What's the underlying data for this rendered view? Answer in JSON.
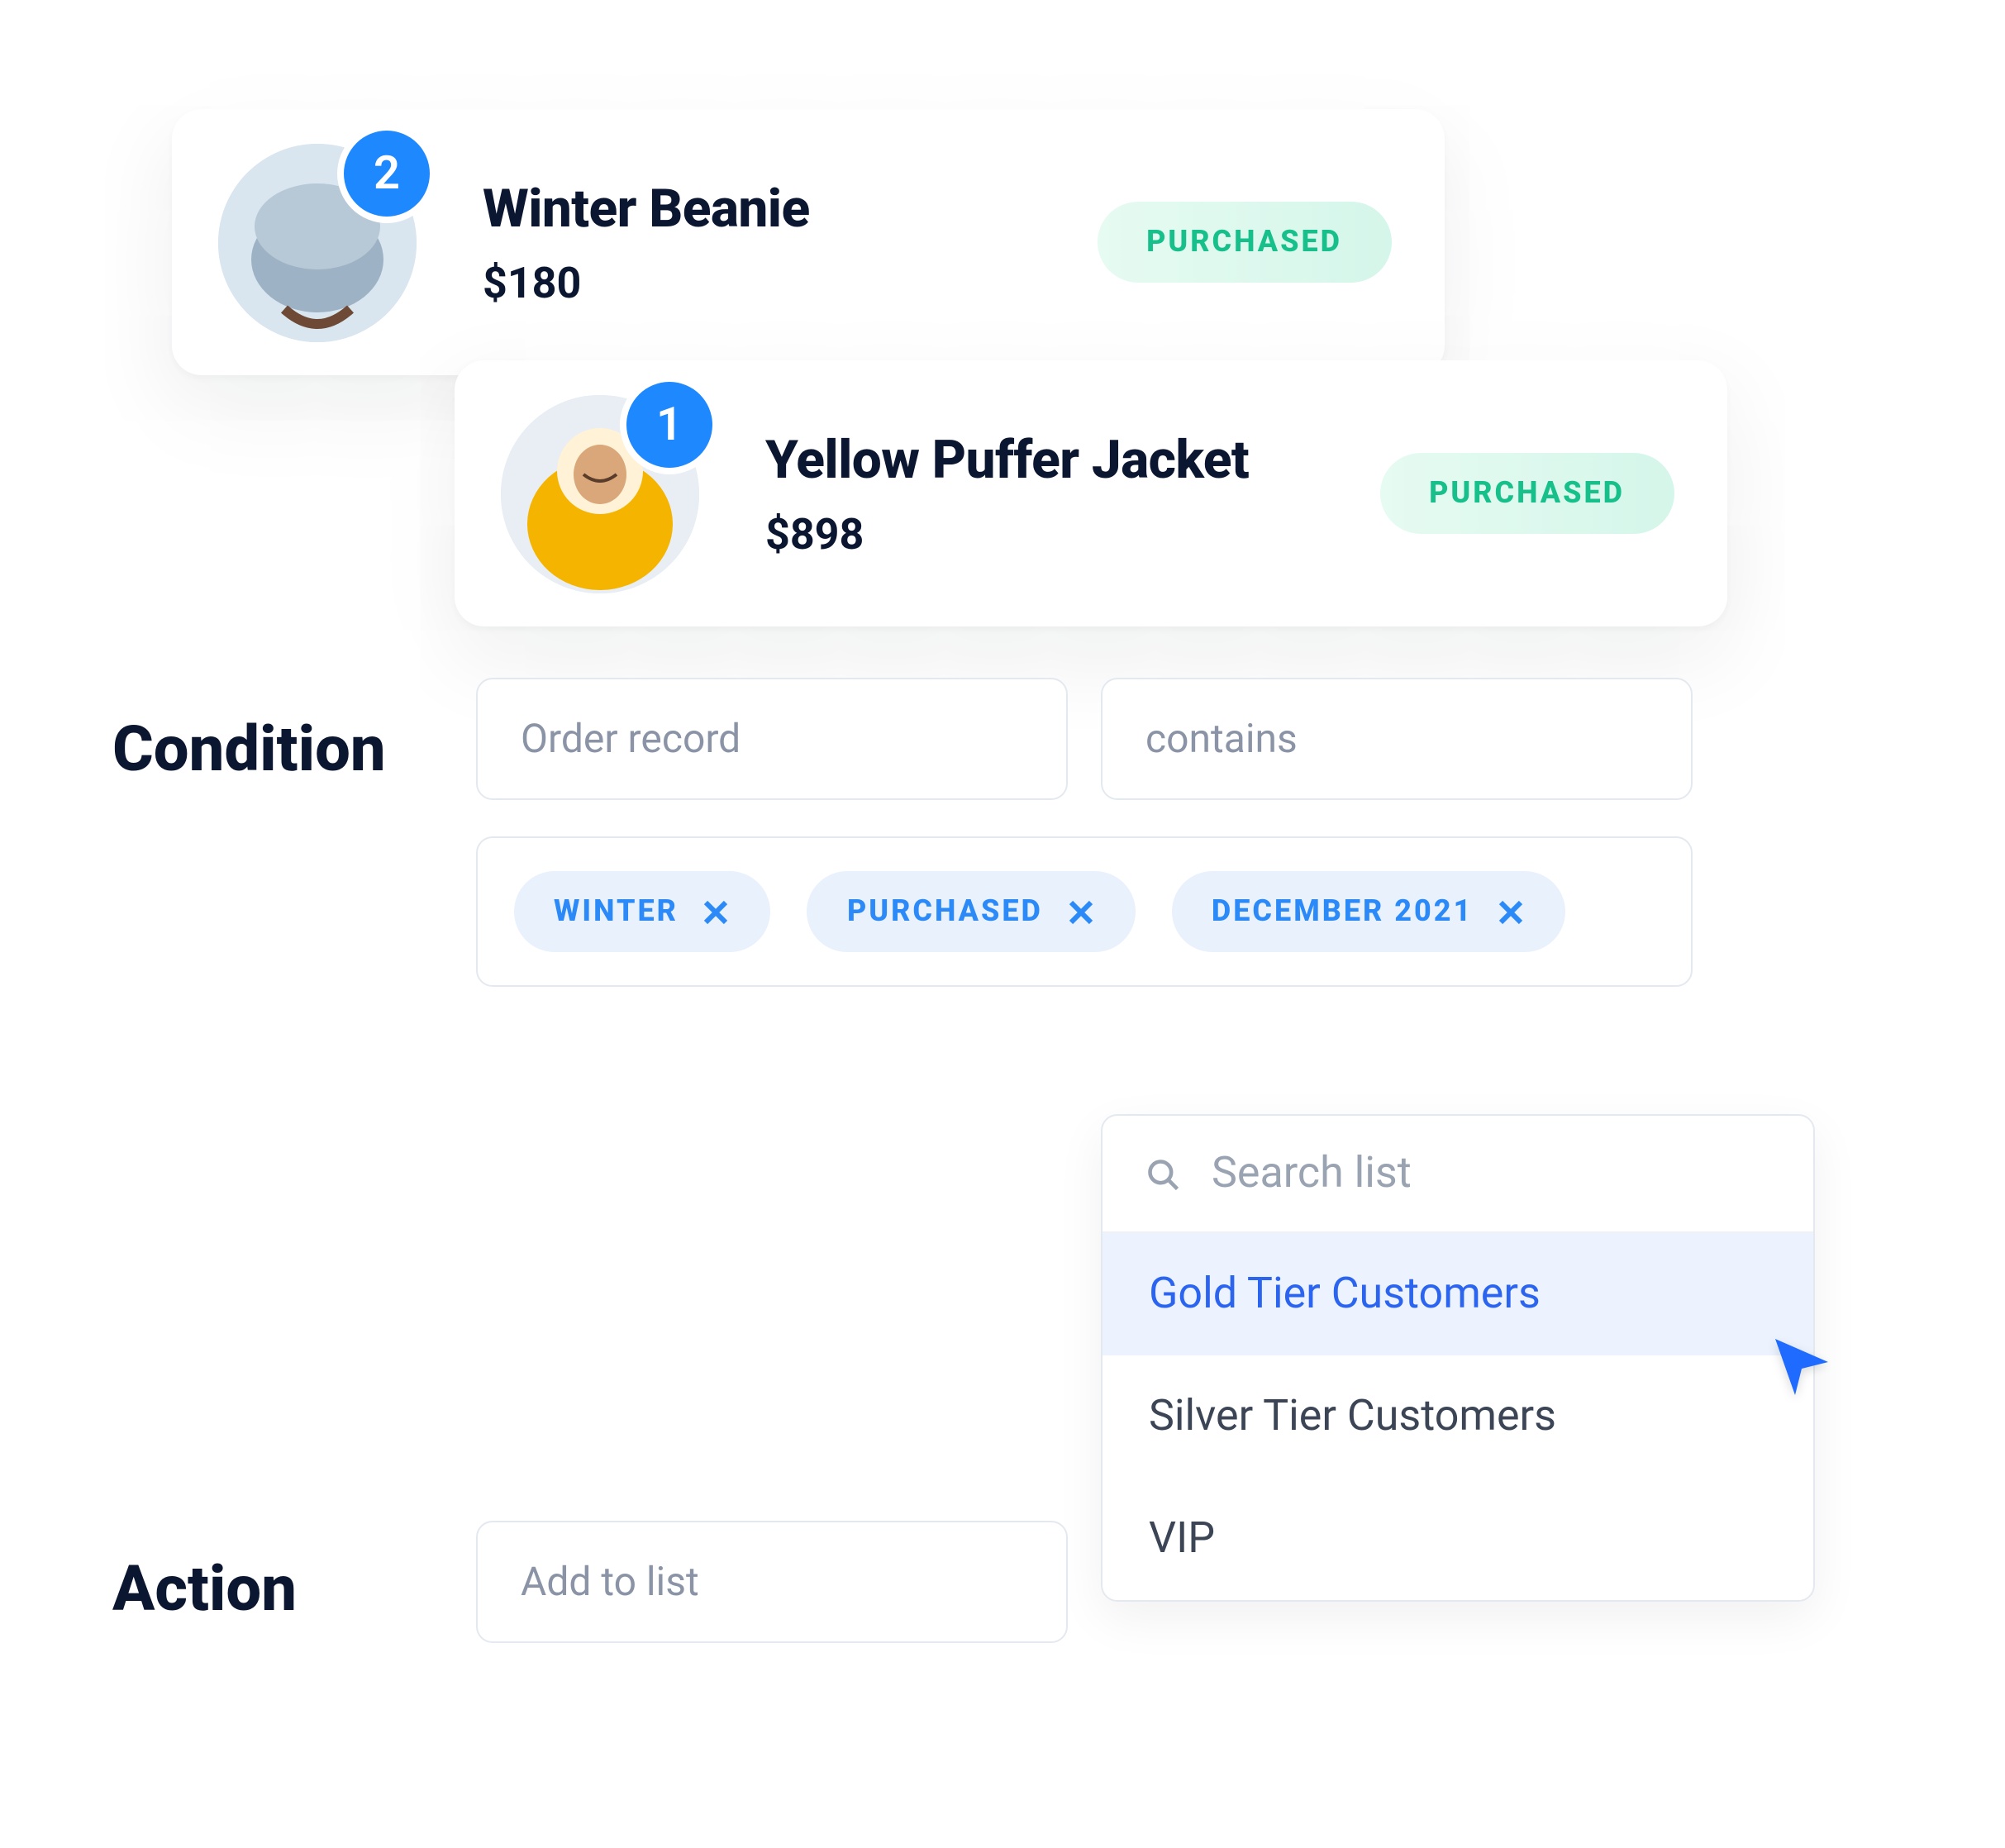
{
  "products": [
    {
      "title": "Winter Beanie",
      "price": "$180",
      "count": "2",
      "status": "PURCHASED"
    },
    {
      "title": "Yellow Puffer Jacket",
      "price": "$898",
      "count": "1",
      "status": "PURCHASED"
    }
  ],
  "condition": {
    "label": "Condition",
    "field_select": "Order record",
    "operator_select": "contains",
    "tags": [
      {
        "label": "WINTER"
      },
      {
        "label": "PURCHASED"
      },
      {
        "label": "DECEMBER 2021"
      }
    ]
  },
  "action": {
    "label": "Action",
    "select": "Add to list"
  },
  "dropdown": {
    "search_placeholder": "Search list",
    "items": [
      {
        "label": "Gold Tier Customers",
        "selected": true
      },
      {
        "label": "Silver Tier Customers",
        "selected": false
      },
      {
        "label": "VIP",
        "selected": false
      }
    ]
  },
  "colors": {
    "primary_blue": "#1e88ff",
    "chip_bg": "#e8f1fc",
    "chip_text": "#2b8af7",
    "status_text": "#17c08a",
    "dark_text": "#0b1630"
  }
}
